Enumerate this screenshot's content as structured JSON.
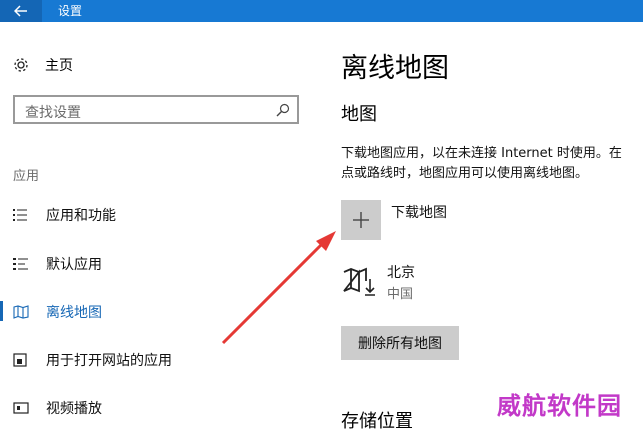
{
  "window": {
    "title": "设置",
    "back_icon": "back-arrow-icon",
    "titlebar_color": "#1779d3"
  },
  "sidebar": {
    "home_label": "主页",
    "home_icon": "gear-icon",
    "search_placeholder": "查找设置",
    "search_icon": "search-icon",
    "section_label": "应用",
    "items": [
      {
        "label": "应用和功能",
        "icon": "list-icon",
        "active": false
      },
      {
        "label": "默认应用",
        "icon": "default-apps-icon",
        "active": false
      },
      {
        "label": "离线地图",
        "icon": "map-icon",
        "active": true
      },
      {
        "label": "用于打开网站的应用",
        "icon": "open-in-app-icon",
        "active": false
      },
      {
        "label": "视频播放",
        "icon": "video-icon",
        "active": false
      }
    ],
    "accent_color": "#1667b5"
  },
  "main": {
    "page_title": "离线地图",
    "section_title": "地图",
    "description_line1": "下载地图应用，以在未连接 Internet 时使用。在",
    "description_line2": "点或路线时，地图应用可以使用离线地图。",
    "add_button_icon": "plus-icon",
    "add_label": "下载地图",
    "downloaded_map": {
      "name": "北京",
      "country": "中国",
      "icon": "map-download-icon"
    },
    "delete_all_label": "删除所有地图",
    "storage_title": "存储位置"
  },
  "annotation": {
    "arrow_color": "#e53935"
  },
  "watermark": "威航软件园"
}
